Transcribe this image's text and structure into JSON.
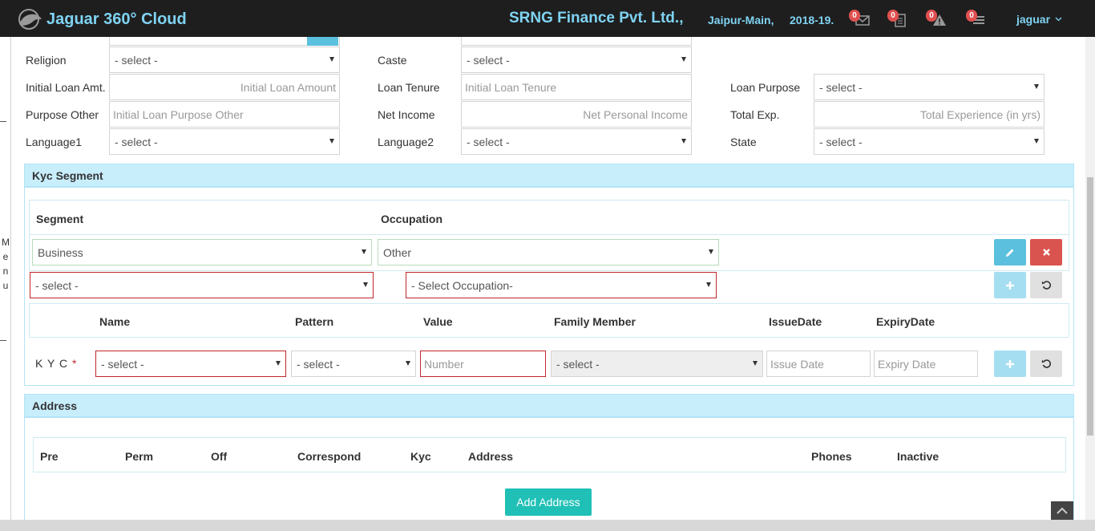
{
  "header": {
    "app_title": "Jaguar 360° Cloud",
    "company": "SRNG Finance Pvt. Ltd.,",
    "branch": "Jaipur-Main,",
    "financial_year": "2018-19.",
    "notifications": [
      {
        "icon": "mail-icon",
        "count": "0"
      },
      {
        "icon": "document-icon",
        "count": "0"
      },
      {
        "icon": "warning-icon",
        "count": "0"
      },
      {
        "icon": "list-icon",
        "count": "0"
      }
    ],
    "user": "jaguar"
  },
  "sidebar": {
    "menu_label": [
      "M",
      "e",
      "n",
      "u"
    ]
  },
  "personal": {
    "religion": {
      "label": "Religion",
      "value": "- select -"
    },
    "caste": {
      "label": "Caste",
      "value": "- select -"
    },
    "initial_loan_amt": {
      "label": "Initial Loan Amt.",
      "placeholder": "Initial Loan Amount"
    },
    "loan_tenure": {
      "label": "Loan Tenure",
      "placeholder": "Initial Loan Tenure"
    },
    "loan_purpose": {
      "label": "Loan Purpose",
      "value": "- select -"
    },
    "purpose_other": {
      "label": "Purpose Other",
      "placeholder": "Initial Loan Purpose Other"
    },
    "net_income": {
      "label": "Net Income",
      "placeholder": "Net Personal Income"
    },
    "total_exp": {
      "label": "Total Exp.",
      "placeholder": "Total Experience (in yrs)"
    },
    "language1": {
      "label": "Language1",
      "value": "- select -"
    },
    "language2": {
      "label": "Language2",
      "value": "- select -"
    },
    "state": {
      "label": "State",
      "value": "- select -"
    }
  },
  "kyc_segment": {
    "title": "Kyc Segment",
    "headers": {
      "segment": "Segment",
      "occupation": "Occupation"
    },
    "existing_row": {
      "segment": "Business",
      "occupation": "Other"
    },
    "new_row": {
      "segment": "- select -",
      "occupation": "- Select Occupation-"
    },
    "kyc_headers": {
      "name": "Name",
      "pattern": "Pattern",
      "value": "Value",
      "family_member": "Family Member",
      "issue_date": "IssueDate",
      "expiry_date": "ExpiryDate"
    },
    "kyc_row": {
      "label": "K Y C",
      "required_mark": "*",
      "name": "- select -",
      "pattern": "- select -",
      "value_placeholder": "Number",
      "family_member": "- select -",
      "issue_date_placeholder": "Issue Date",
      "expiry_date_placeholder": "Expiry Date"
    }
  },
  "address": {
    "title": "Address",
    "headers": [
      "Pre",
      "Perm",
      "Off",
      "Correspond",
      "Kyc",
      "Address",
      "Phones",
      "Inactive"
    ],
    "add_button": "Add Address"
  }
}
